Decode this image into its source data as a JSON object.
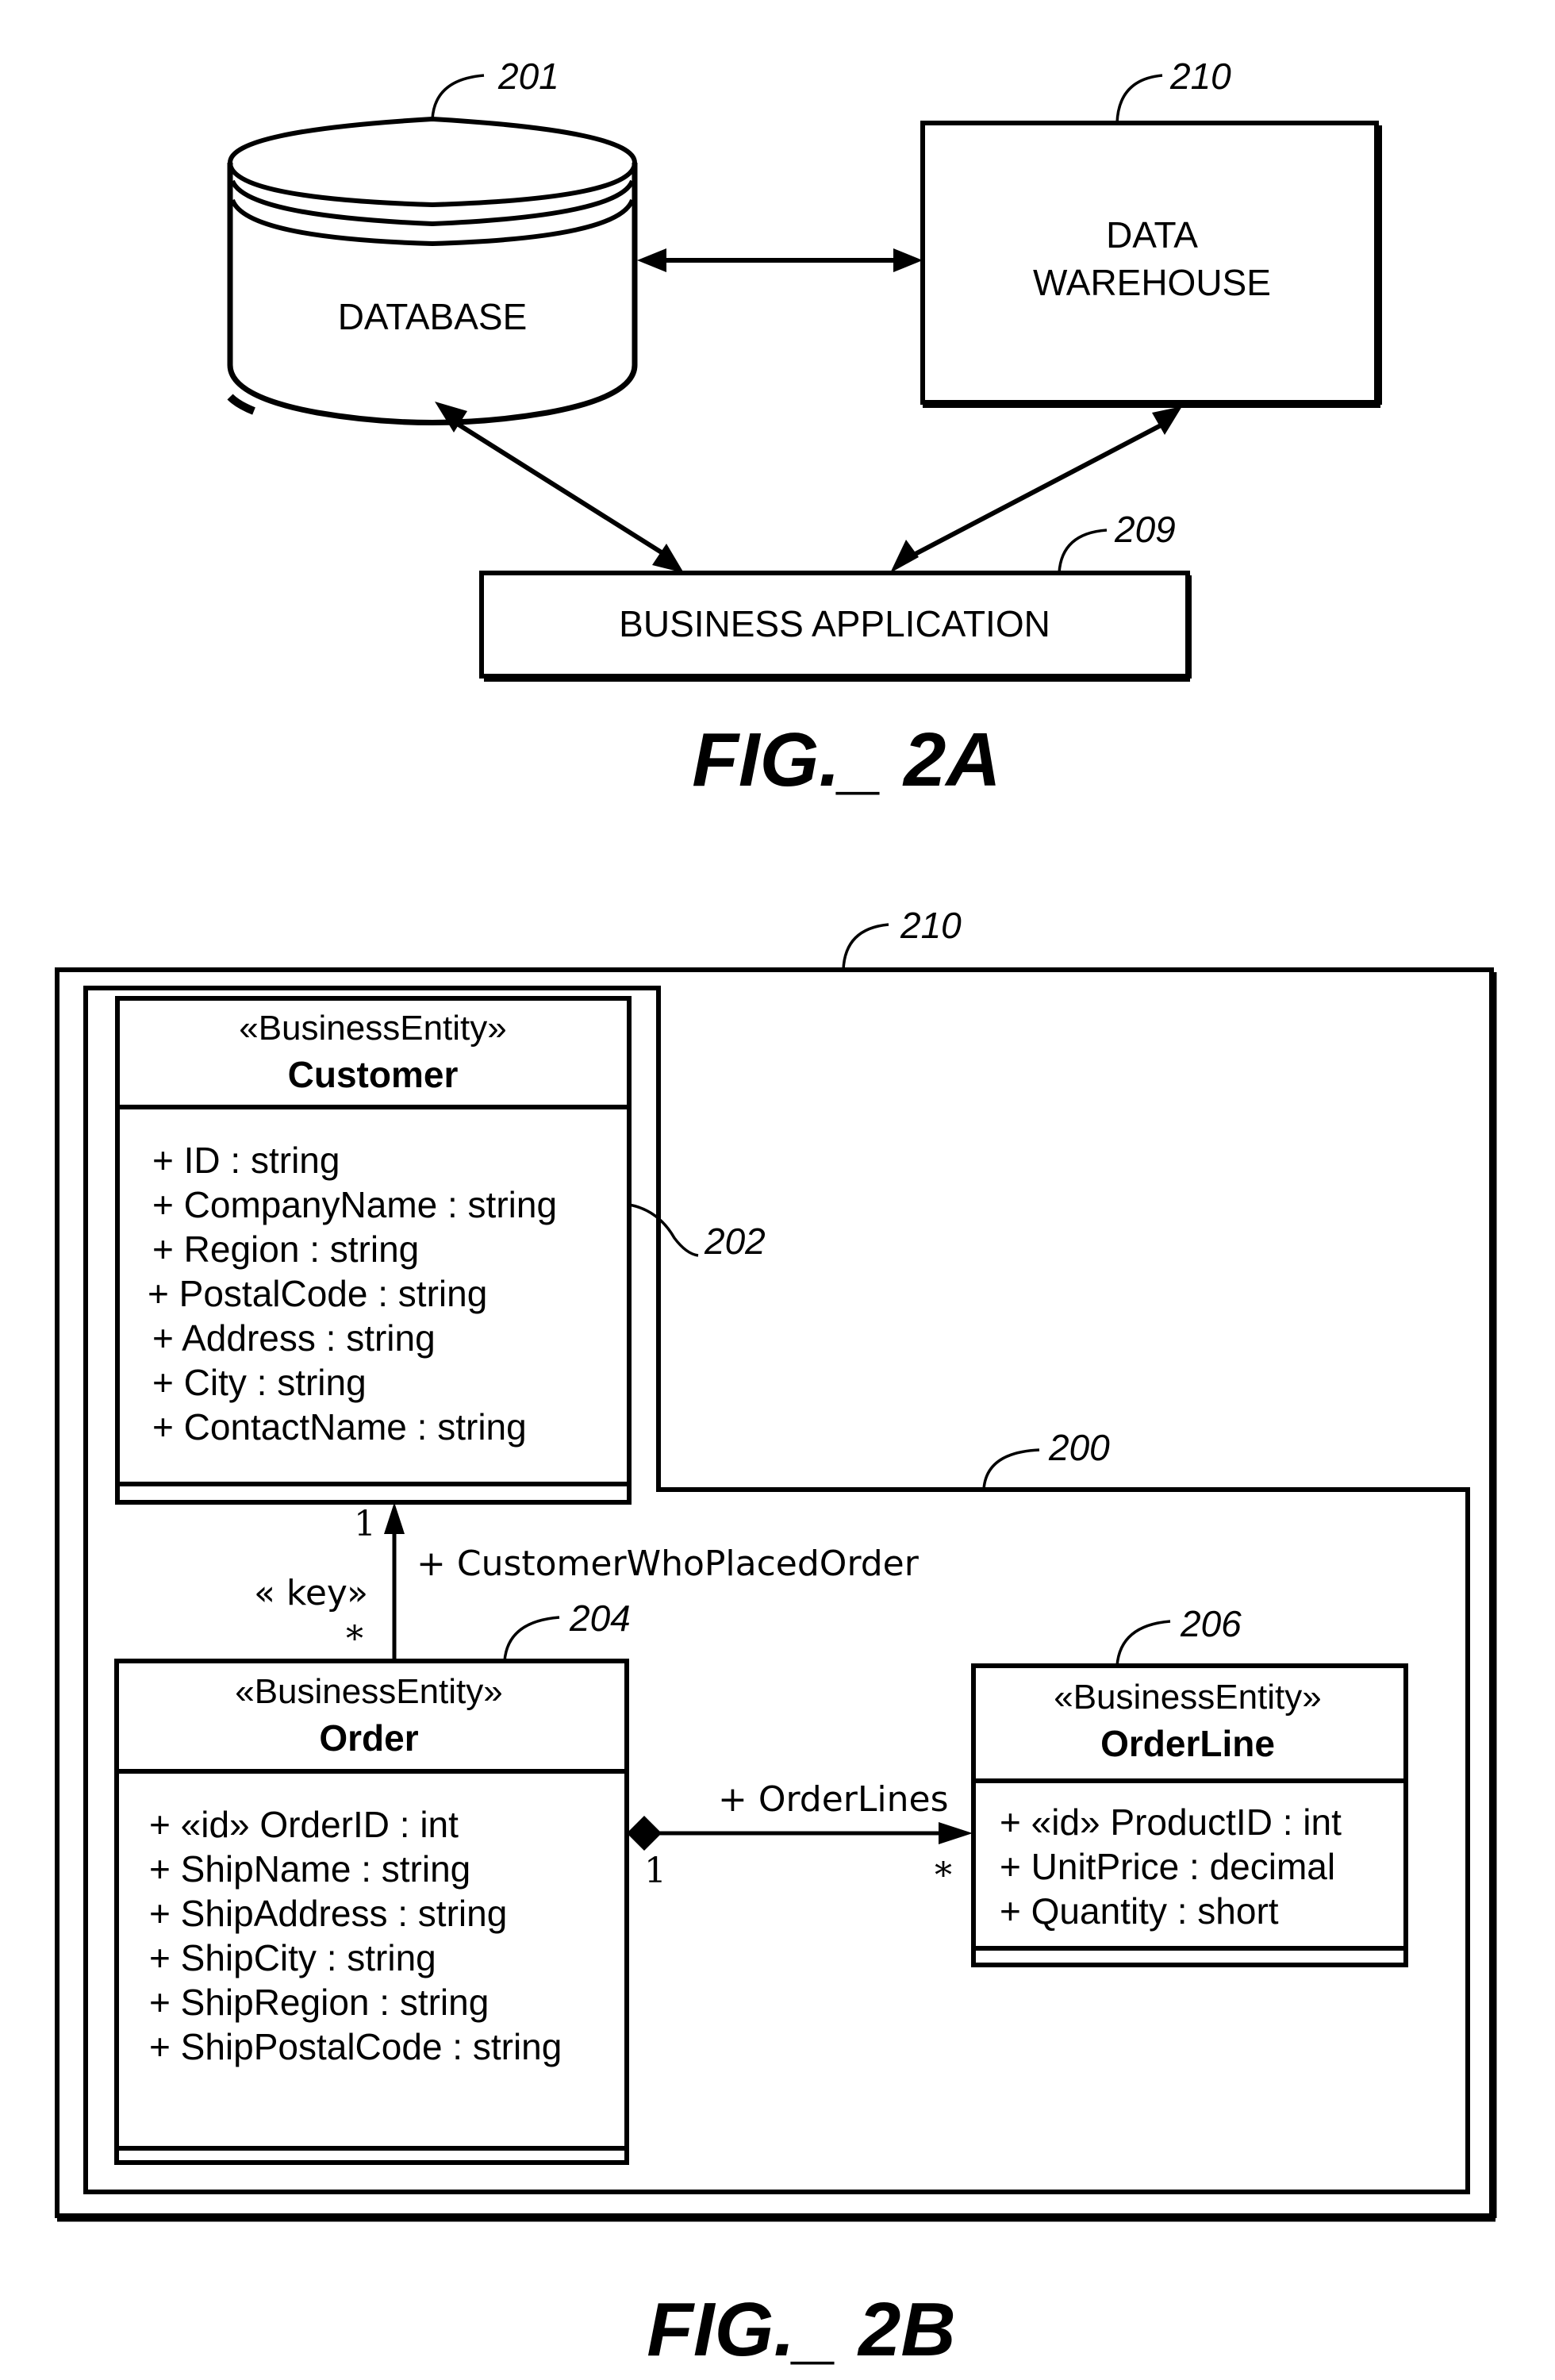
{
  "fig2a": {
    "caption": "FIG._ 2A",
    "database": {
      "label": "DATABASE",
      "ref": "201"
    },
    "data_warehouse": {
      "label_line1": "DATA",
      "label_line2": "WAREHOUSE",
      "ref": "210"
    },
    "business_application": {
      "label": "BUSINESS APPLICATION",
      "ref": "209"
    },
    "connections": [
      {
        "from": "database",
        "to": "data_warehouse",
        "type": "bidirectional"
      },
      {
        "from": "database",
        "to": "business_application",
        "type": "bidirectional"
      },
      {
        "from": "data_warehouse",
        "to": "business_application",
        "type": "bidirectional"
      }
    ]
  },
  "fig2b": {
    "caption": "FIG._ 2B",
    "outer_container_ref": "210",
    "model_container_ref": "200",
    "classes": {
      "customer": {
        "ref": "202",
        "stereotype": "«BusinessEntity»",
        "name": "Customer",
        "attributes": [
          "+ ID : string",
          "+ CompanyName : string",
          "+ Region : string",
          "+ PostalCode : string",
          "+ Address : string",
          "+ City : string",
          "+ ContactName : string"
        ]
      },
      "order": {
        "ref": "204",
        "stereotype": "«BusinessEntity»",
        "name": "Order",
        "attributes": [
          "+ «id» OrderID : int",
          "+ ShipName : string",
          "+ ShipAddress : string",
          "+ ShipCity : string",
          "+ ShipRegion : string",
          "+ ShipPostalCode : string"
        ]
      },
      "orderline": {
        "ref": "206",
        "stereotype": "«BusinessEntity»",
        "name": "OrderLine",
        "attributes": [
          "+ «id» ProductID : int",
          "+ UnitPrice : decimal",
          "+ Quantity : short"
        ]
      }
    },
    "associations": {
      "customer_order": {
        "role": "+  CustomerWhoPlacedOrder",
        "stereotype": "« key»",
        "mult_target": "1",
        "mult_source": "*"
      },
      "order_orderline": {
        "role": "+  OrderLines",
        "mult_source": "1",
        "mult_target": "*"
      }
    }
  }
}
